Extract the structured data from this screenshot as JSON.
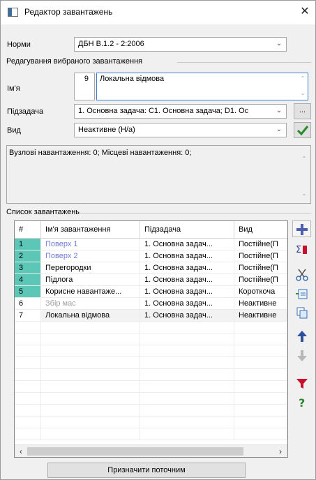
{
  "window": {
    "title": "Редактор завантажень",
    "close_glyph": "✕"
  },
  "norms": {
    "label": "Норми",
    "value": "ДБН В.1.2 - 2:2006"
  },
  "edit_group": {
    "title": "Редагування вибраного завантаження",
    "name_label": "Ім'я",
    "number": "9",
    "name_value": "Локальна відмова",
    "subtask_label": "Підзадача",
    "subtask_value": "1. Основна задача: C1. Основна задача; D1. Ос",
    "type_label": "Вид",
    "type_value": "Неактивне (Н/а)",
    "ellipsis_label": "...",
    "apply_icon": "check-icon"
  },
  "info": {
    "text": "Вузлові навантаження:  0;  Місцеві навантаження:  0;"
  },
  "list": {
    "title": "Список завантажень",
    "columns": [
      "#",
      "Ім'я завантаження",
      "Підзадача",
      "Вид"
    ],
    "rows": [
      {
        "num": "1",
        "name": "Поверх 1",
        "subtask": "1. Основна задач...",
        "type": "Постійне(П",
        "name_color": "#6f7bd6",
        "num_bg": "#5cc7b6"
      },
      {
        "num": "2",
        "name": "Поверх 2",
        "subtask": "1. Основна задач...",
        "type": "Постійне(П",
        "name_color": "#6f7bd6",
        "num_bg": "#5cc7b6"
      },
      {
        "num": "3",
        "name": "Перегородки",
        "subtask": "1. Основна задач...",
        "type": "Постійне(П",
        "name_color": "#000000",
        "num_bg": "#5cc7b6"
      },
      {
        "num": "4",
        "name": "Підлога",
        "subtask": "1. Основна задач...",
        "type": "Постійне(П",
        "name_color": "#000000",
        "num_bg": "#5cc7b6"
      },
      {
        "num": "5",
        "name": "Корисне навантаже...",
        "subtask": "1. Основна задач...",
        "type": "Короткоча",
        "name_color": "#000000",
        "num_bg": "#5cc7b6"
      },
      {
        "num": "6",
        "name": "Збір мас",
        "subtask": "1. Основна задач...",
        "type": "Неактивне",
        "name_color": "#a0a0a0",
        "num_bg": "#ffffff"
      },
      {
        "num": "7",
        "name": "Локальна відмова",
        "subtask": "1. Основна задач...",
        "type": "Неактивне",
        "name_color": "#000000",
        "num_bg": "#ffffff"
      }
    ]
  },
  "toolbar": {
    "icons": [
      "add-icon",
      "sum-icon",
      "cut-icon",
      "insert-icon",
      "copy-icon",
      "move-up-icon",
      "move-down-icon",
      "filter-icon",
      "help-icon"
    ]
  },
  "footer": {
    "assign_label": "Призначити поточним"
  },
  "colors": {
    "accent_blue": "#3d7ed0",
    "selected_row": "#f2f2f2",
    "check_green": "#2b8a2b",
    "red_icon": "#c8102e"
  }
}
